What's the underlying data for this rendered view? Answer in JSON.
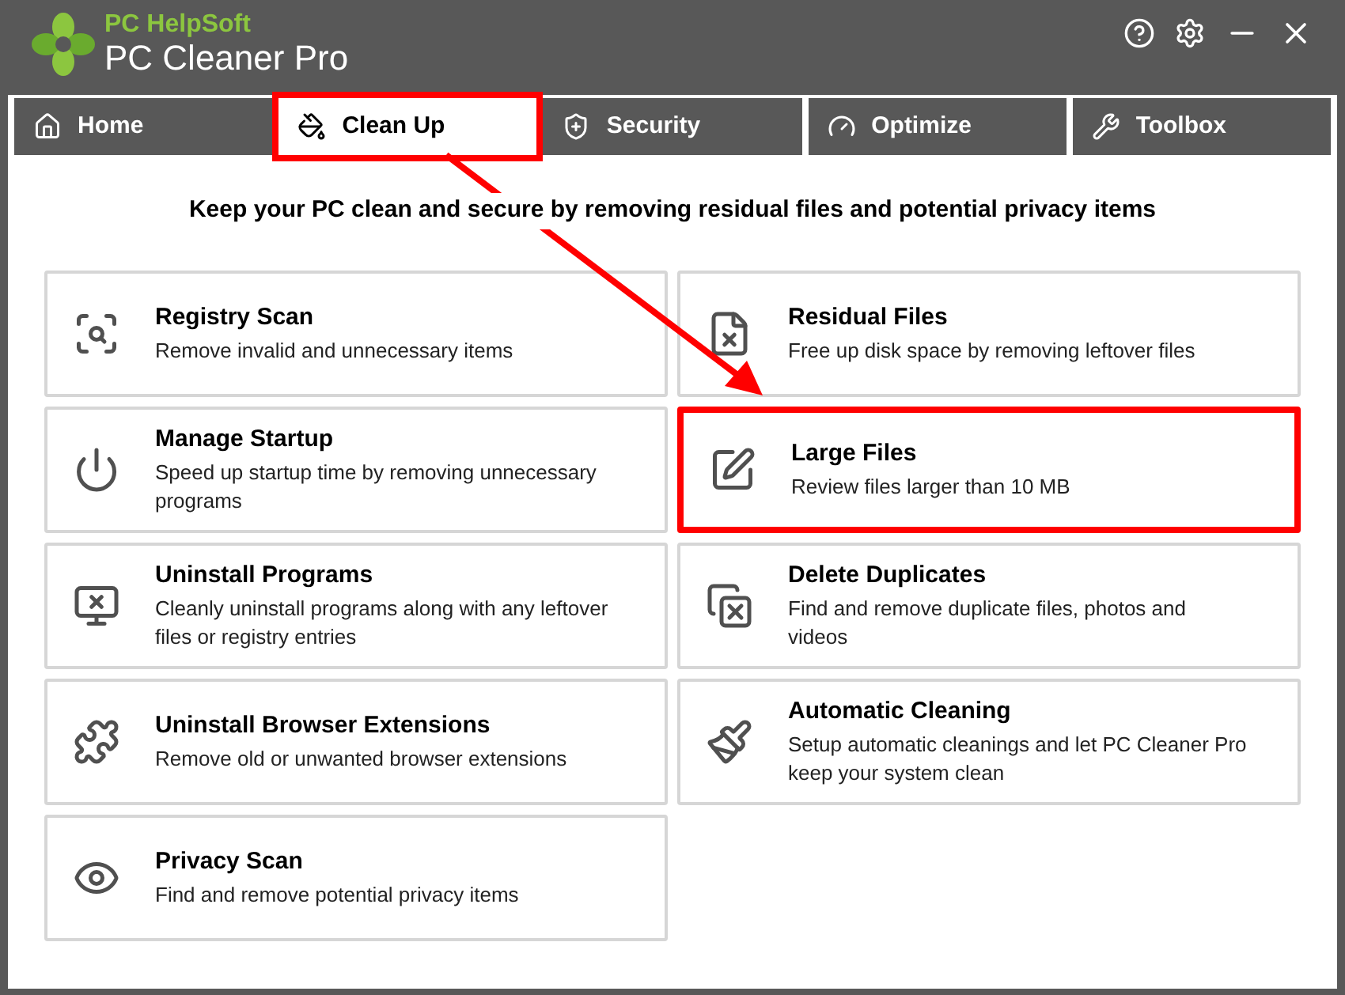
{
  "app": {
    "vendor": "PC HelpSoft",
    "title": "PC Cleaner Pro"
  },
  "tabs": [
    {
      "label": "Home",
      "selected": false,
      "highlighted": false
    },
    {
      "label": "Clean Up",
      "selected": true,
      "highlighted": true
    },
    {
      "label": "Security",
      "selected": false,
      "highlighted": false
    },
    {
      "label": "Optimize",
      "selected": false,
      "highlighted": false
    },
    {
      "label": "Toolbox",
      "selected": false,
      "highlighted": false
    }
  ],
  "heading": "Keep your PC clean and secure by removing residual files and potential privacy items",
  "columns": [
    {
      "tools": [
        {
          "title": "Registry Scan",
          "description": "Remove invalid and unnecessary items",
          "highlighted": false
        },
        {
          "title": "Manage Startup",
          "description": "Speed up startup time by removing unnecessary programs",
          "highlighted": false
        },
        {
          "title": "Uninstall Programs",
          "description": "Cleanly uninstall programs along with any leftover files or registry entries",
          "highlighted": false
        },
        {
          "title": "Uninstall Browser Extensions",
          "description": "Remove old or unwanted browser extensions",
          "highlighted": false
        },
        {
          "title": "Privacy Scan",
          "description": "Find and remove potential privacy items",
          "highlighted": false
        }
      ]
    },
    {
      "tools": [
        {
          "title": "Residual Files",
          "description": "Free up disk space by removing leftover files",
          "highlighted": false
        },
        {
          "title": "Large Files",
          "description": "Review files larger than 10 MB",
          "highlighted": true
        },
        {
          "title": "Delete Duplicates",
          "description": "Find and remove duplicate files, photos and videos",
          "highlighted": false
        },
        {
          "title": "Automatic Cleaning",
          "description": "Setup automatic cleanings and let PC Cleaner Pro keep your system clean",
          "highlighted": false
        }
      ]
    }
  ]
}
